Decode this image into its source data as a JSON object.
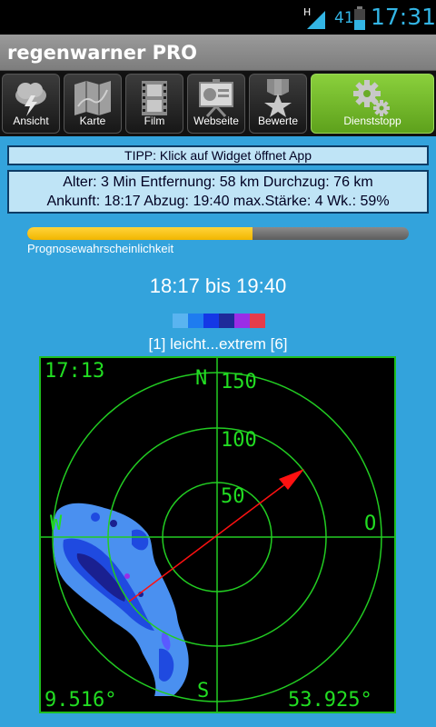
{
  "status": {
    "network": "H",
    "battery": "41",
    "time": "17:31"
  },
  "app": {
    "title": "regenwarner PRO"
  },
  "toolbar": [
    {
      "label": "Ansicht",
      "icon": "weather-icon"
    },
    {
      "label": "Karte",
      "icon": "map-icon"
    },
    {
      "label": "Film",
      "icon": "film-icon"
    },
    {
      "label": "Webseite",
      "icon": "presentation-icon"
    },
    {
      "label": "Bewerte",
      "icon": "medal-icon"
    },
    {
      "label": "Dienststopp",
      "icon": "gears-icon"
    }
  ],
  "tipp": "TIPP: Klick auf Widget öffnet App",
  "info": {
    "line1": "Alter: 3 Min  Entfernung: 58 km  Durchzug: 76 km",
    "line2": "Ankunft: 18:17  Abzug: 19:40  max.Stärke: 4  Wk.: 59%"
  },
  "probability": {
    "value": 0.59,
    "label": "Prognosewahrscheinlichkeit"
  },
  "timespan": "18:17 bis 19:40",
  "intensity_scale": {
    "colors": [
      "#5ab4f0",
      "#1e7cf0",
      "#1438e6",
      "#1e2a9a",
      "#9a2ee6",
      "#e63c4a"
    ],
    "label": "[1] leicht...extrem [6]"
  },
  "radar": {
    "time": "17:13",
    "north": "N",
    "south": "S",
    "east": "O",
    "west": "W",
    "rings": [
      "50",
      "100",
      "150"
    ],
    "lon": "9.516°",
    "lat": "53.925°",
    "colors": {
      "grid": "#22cc22",
      "arrow": "#ff1111",
      "rain_light": "#4a90f0",
      "rain_med": "#1f4ae0",
      "rain_dark": "#1a2090"
    }
  }
}
